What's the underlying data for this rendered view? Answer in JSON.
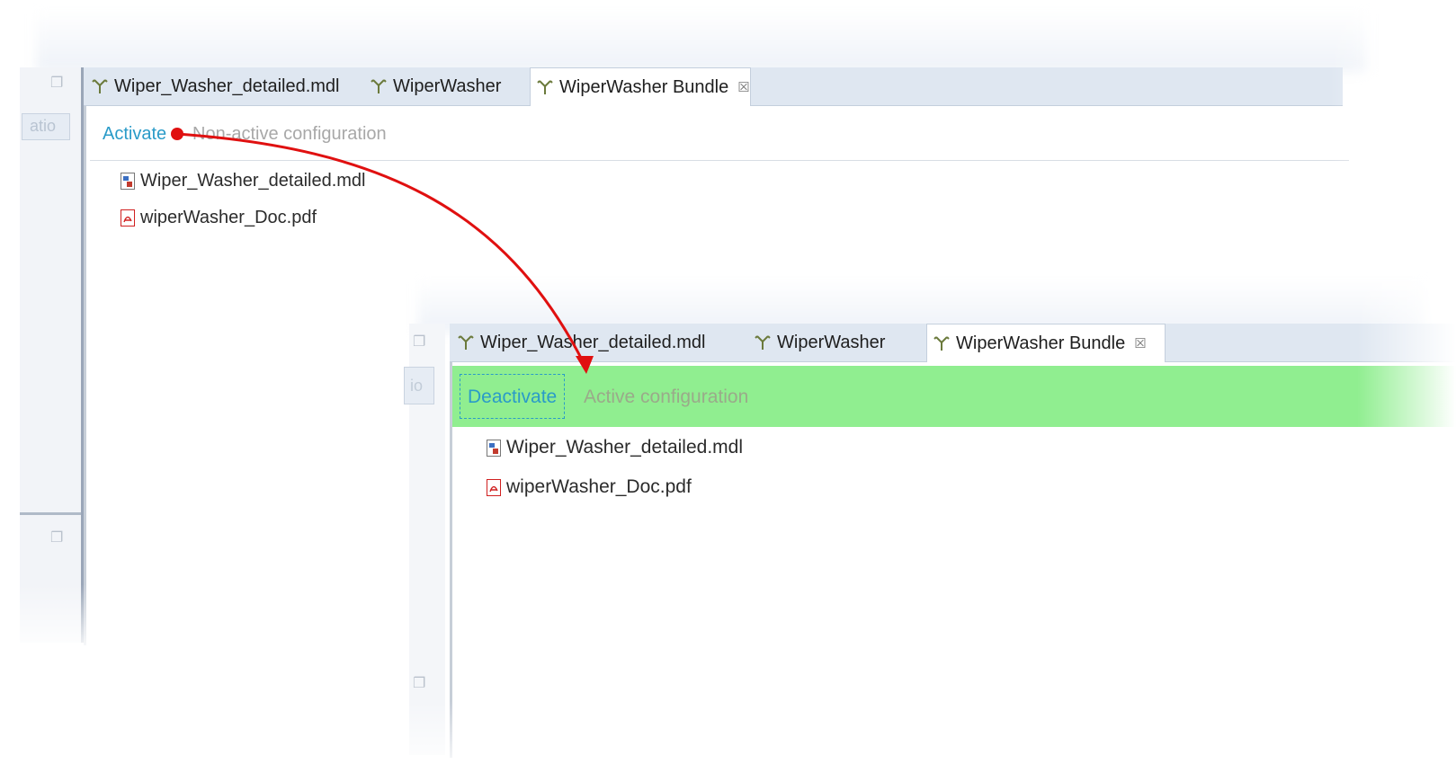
{
  "top_panel": {
    "tabs": [
      {
        "label": "Wiper_Washer_detailed.mdl",
        "icon": "bundle-icon"
      },
      {
        "label": "WiperWasher",
        "icon": "bundle-icon"
      },
      {
        "label": "WiperWasher Bundle",
        "icon": "bundle-icon",
        "active": true,
        "close": "☒"
      }
    ],
    "side_label": "atio",
    "action_link": "Activate",
    "status_text": "Non-active configuration",
    "files": [
      {
        "name": "Wiper_Washer_detailed.mdl",
        "icon": "model-file-icon"
      },
      {
        "name": "wiperWasher_Doc.pdf",
        "icon": "pdf-file-icon"
      }
    ]
  },
  "bottom_panel": {
    "tabs": [
      {
        "label": "Wiper_Washer_detailed.mdl",
        "icon": "bundle-icon"
      },
      {
        "label": "WiperWasher",
        "icon": "bundle-icon"
      },
      {
        "label": "WiperWasher Bundle",
        "icon": "bundle-icon",
        "active": true,
        "close": "☒"
      }
    ],
    "side_label": "io",
    "action_link": "Deactivate",
    "status_text": "Active configuration",
    "files": [
      {
        "name": "Wiper_Washer_detailed.mdl",
        "icon": "model-file-icon"
      },
      {
        "name": "wiperWasher_Doc.pdf",
        "icon": "pdf-file-icon"
      }
    ]
  },
  "colors": {
    "link": "#2a9bc8",
    "active_bar": "#90ee90",
    "arrow": "#e01010",
    "muted_text": "#a8a8a8"
  }
}
